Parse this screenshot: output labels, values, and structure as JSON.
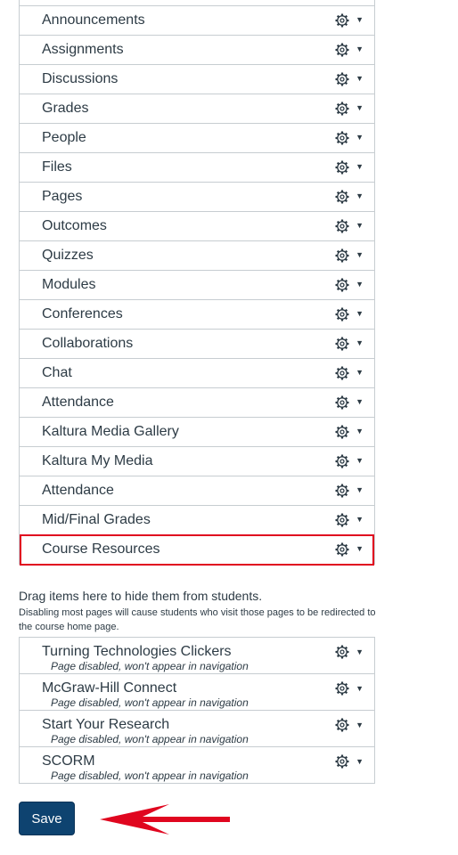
{
  "nav_items": [
    {
      "label": ""
    },
    {
      "label": "Announcements"
    },
    {
      "label": "Assignments"
    },
    {
      "label": "Discussions"
    },
    {
      "label": "Grades"
    },
    {
      "label": "People"
    },
    {
      "label": "Files"
    },
    {
      "label": "Pages"
    },
    {
      "label": "Outcomes"
    },
    {
      "label": "Quizzes"
    },
    {
      "label": "Modules"
    },
    {
      "label": "Conferences"
    },
    {
      "label": "Collaborations"
    },
    {
      "label": "Chat"
    },
    {
      "label": "Attendance"
    },
    {
      "label": "Kaltura Media Gallery"
    },
    {
      "label": "Kaltura My Media"
    },
    {
      "label": "Attendance"
    },
    {
      "label": "Mid/Final Grades"
    },
    {
      "label": "Course Resources"
    }
  ],
  "hidden_section": {
    "title": "Drag items here to hide them from students.",
    "note": "Disabling most pages will cause students who visit those pages to be redirected to the course home page.",
    "items": [
      {
        "label": "Turning Technologies Clickers",
        "sub": "Page disabled, won't appear in navigation"
      },
      {
        "label": "McGraw-Hill Connect",
        "sub": "Page disabled, won't appear in navigation"
      },
      {
        "label": "Start Your Research",
        "sub": "Page disabled, won't appear in navigation"
      },
      {
        "label": "SCORM",
        "sub": "Page disabled, won't appear in navigation"
      }
    ]
  },
  "save_label": "Save",
  "colors": {
    "highlight": "#e0061f",
    "button": "#0e4370",
    "text": "#2d3b45",
    "border": "#c7cdd1"
  }
}
